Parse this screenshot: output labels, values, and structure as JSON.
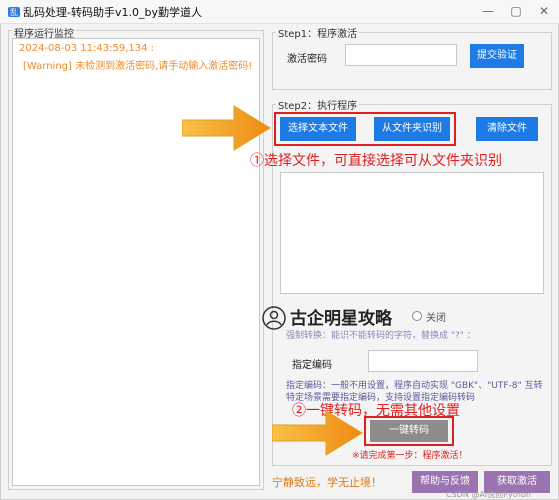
{
  "window": {
    "title": "乱码处理-转码助手v1.0_by勤学道人",
    "minimize": "—",
    "maximize": "▢",
    "close": "✕"
  },
  "log_panel": {
    "title": "程序运行监控",
    "lines": [
      "2024-08-03 11:43:59,134 :",
      "[Warning] 未检测到激活密码,请手动输入激活密码!"
    ]
  },
  "step1": {
    "title": "Step1：程序激活",
    "password_label": "激活密码",
    "password_value": "",
    "submit_label": "提交验证"
  },
  "step2": {
    "title": "Step2：执行程序",
    "select_file_label": "选择文本文件",
    "from_folder_label": "从文件夹识别",
    "clear_label": "清除文件",
    "annotation_1": "①选择文件，可直接选择可从文件夹识别",
    "overlay_title": "古企明星攻略",
    "toggle_label": "关闭",
    "forced_hint": "强制转换：能识不能转码的字符，替换成 \"?\" ：",
    "encoding_label": "指定编码",
    "encoding_value": "",
    "encoding_note_1": "指定编码：一般不用设置，程序自动实现 \"GBK\"、\"UTF-8\" 互转",
    "encoding_note_2": "特定场景需要指定编码，支持设置指定编码转码",
    "annotation_2": "②一键转码，无需其他设置",
    "convert_label": "一键转码",
    "convert_warning": "※请完成第一步：程序激活！"
  },
  "footer": {
    "motto": "宁静致远，学无止境！",
    "help_label": "帮助与反馈",
    "get_activation_label": "获取激活",
    "watermark": "CSDN @AI悦创Python"
  },
  "colors": {
    "blue_button": "#1e7be6",
    "red_annotation": "#e02020",
    "orange_arrow": "#f5a623",
    "log_text": "#f08a2a",
    "purple_button": "#9a73b0"
  }
}
